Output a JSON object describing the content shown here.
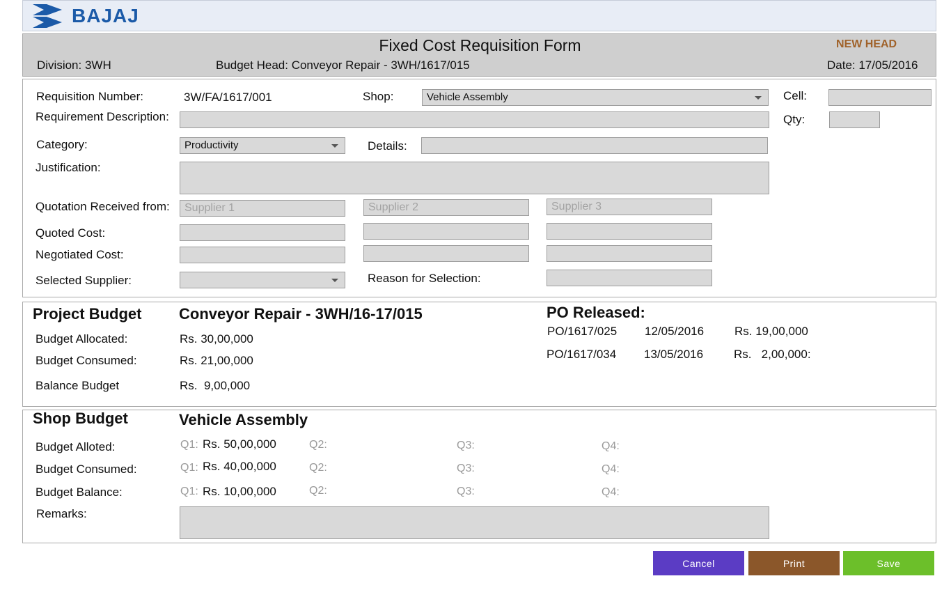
{
  "brand": {
    "name": "BAJAJ"
  },
  "header": {
    "title": "Fixed Cost Requisition Form",
    "new_head": "NEW HEAD",
    "division": "Division: 3WH",
    "budget_head": "Budget Head: Conveyor Repair - 3WH/1617/015",
    "date": "Date: 17/05/2016"
  },
  "form": {
    "requisition_number_label": "Requisition Number:",
    "requisition_number_value": "3W/FA/1617/001",
    "shop_label": "Shop:",
    "shop_value": "Vehicle Assembly",
    "cell_label": "Cell:",
    "cell_value": "",
    "requirement_label": "Requirement Description:",
    "requirement_value": "",
    "qty_label": "Qty:",
    "qty_value": "",
    "category_label": "Category:",
    "category_value": "Productivity",
    "details_label": "Details:",
    "details_value": "",
    "justification_label": "Justification:",
    "justification_value": "",
    "quotation_label": "Quotation Received from:",
    "suppliers": [
      {
        "placeholder": "Supplier 1",
        "value": ""
      },
      {
        "placeholder": "Supplier 2",
        "value": ""
      },
      {
        "placeholder": "Supplier 3",
        "value": ""
      }
    ],
    "quoted_cost_label": "Quoted Cost:",
    "negotiated_cost_label": "Negotiated Cost:",
    "selected_supplier_label": "Selected Supplier:",
    "selected_supplier_value": "",
    "reason_label": "Reason for Selection:",
    "reason_value": ""
  },
  "project_budget": {
    "title": "Project Budget",
    "name": "Conveyor Repair - 3WH/16-17/015",
    "allocated_label": "Budget Allocated:",
    "allocated_value": "Rs. 30,00,000",
    "consumed_label": "Budget Consumed:",
    "consumed_value": "Rs. 21,00,000",
    "balance_label": "Balance Budget",
    "balance_value": "Rs.  9,00,000",
    "po_title": "PO Released:",
    "po_rows": [
      {
        "po": "PO/1617/025",
        "date": "12/05/2016",
        "amount": "Rs. 19,00,000"
      },
      {
        "po": "PO/1617/034",
        "date": "13/05/2016",
        "amount": "Rs.   2,00,000:"
      }
    ]
  },
  "shop_budget": {
    "title": "Shop Budget",
    "name": "Vehicle Assembly",
    "rows": [
      {
        "label": "Budget Alloted:",
        "q1": "Q1:",
        "q1_value": "Rs. 50,00,000",
        "q2": "Q2:",
        "q3": "Q3:",
        "q4": "Q4:"
      },
      {
        "label": "Budget Consumed:",
        "q1": "Q1:",
        "q1_value": "Rs. 40,00,000",
        "q2": "Q2:",
        "q3": "Q3:",
        "q4": "Q4:"
      },
      {
        "label": "Budget Balance:",
        "q1": "Q1:",
        "q1_value": "Rs. 10,00,000",
        "q2": "Q2:",
        "q3": "Q3:",
        "q4": "Q4:"
      }
    ],
    "remarks_label": "Remarks:",
    "remarks_value": ""
  },
  "actions": {
    "cancel": "Cancel",
    "print": "Print",
    "save": "Save"
  },
  "colors": {
    "logo_bar": "#e8edf6",
    "header_bar": "#cfcfcf",
    "brand_blue": "#1b5aa8",
    "new_head": "#a0622a",
    "cancel": "#5b3cc4",
    "print": "#8b572a",
    "save": "#6cbf2a"
  }
}
